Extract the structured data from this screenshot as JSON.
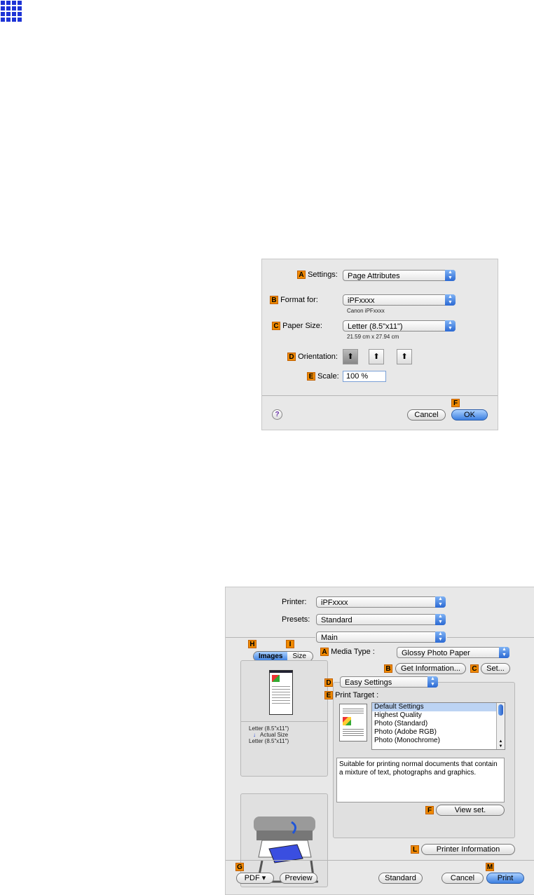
{
  "page_setup": {
    "settings_label": "Settings:",
    "settings_value": "Page Attributes",
    "format_label": "Format for:",
    "format_value": "iPFxxxx",
    "format_note": "Canon iPFxxxx",
    "paper_label": "Paper Size:",
    "paper_value": "Letter (8.5\"x11\")",
    "paper_note": "21.59 cm x 27.94 cm",
    "orientation_label": "Orientation:",
    "scale_label": "Scale:",
    "scale_value": "100 %",
    "help": "?",
    "cancel": "Cancel",
    "ok": "OK",
    "tags": {
      "a": "A",
      "b": "B",
      "c": "C",
      "d": "D",
      "e": "E",
      "f": "F"
    }
  },
  "print_dialog": {
    "printer_label": "Printer:",
    "printer_value": "iPFxxxx",
    "presets_label": "Presets:",
    "presets_value": "Standard",
    "panel_value": "Main",
    "tab_images": "Images",
    "tab_size": "Size",
    "preview_lines": [
      "Letter (8.5\"x11\")",
      "Actual Size",
      "Letter (8.5\"x11\")"
    ],
    "media_type_label": "Media Type :",
    "media_type_value": "Glossy Photo Paper",
    "get_info": "Get Information...",
    "set": "Set...",
    "easy_settings": "Easy Settings",
    "print_target_label": "Print Target :",
    "targets": [
      "Default Settings",
      "Highest Quality",
      "Photo (Standard)",
      "Photo (Adobe RGB)",
      "Photo (Monochrome)"
    ],
    "description": "Suitable for printing normal documents that contain a mixture of text, photographs and graphics.",
    "view_set": "View set.",
    "printer_info": "Printer Information",
    "pdf": "PDF ▾",
    "preview": "Preview",
    "standard": "Standard",
    "cancel": "Cancel",
    "print": "Print",
    "tags": {
      "a": "A",
      "b": "B",
      "c": "C",
      "d": "D",
      "e": "E",
      "f": "F",
      "g": "G",
      "h": "H",
      "i": "I",
      "l": "L",
      "m": "M"
    }
  }
}
